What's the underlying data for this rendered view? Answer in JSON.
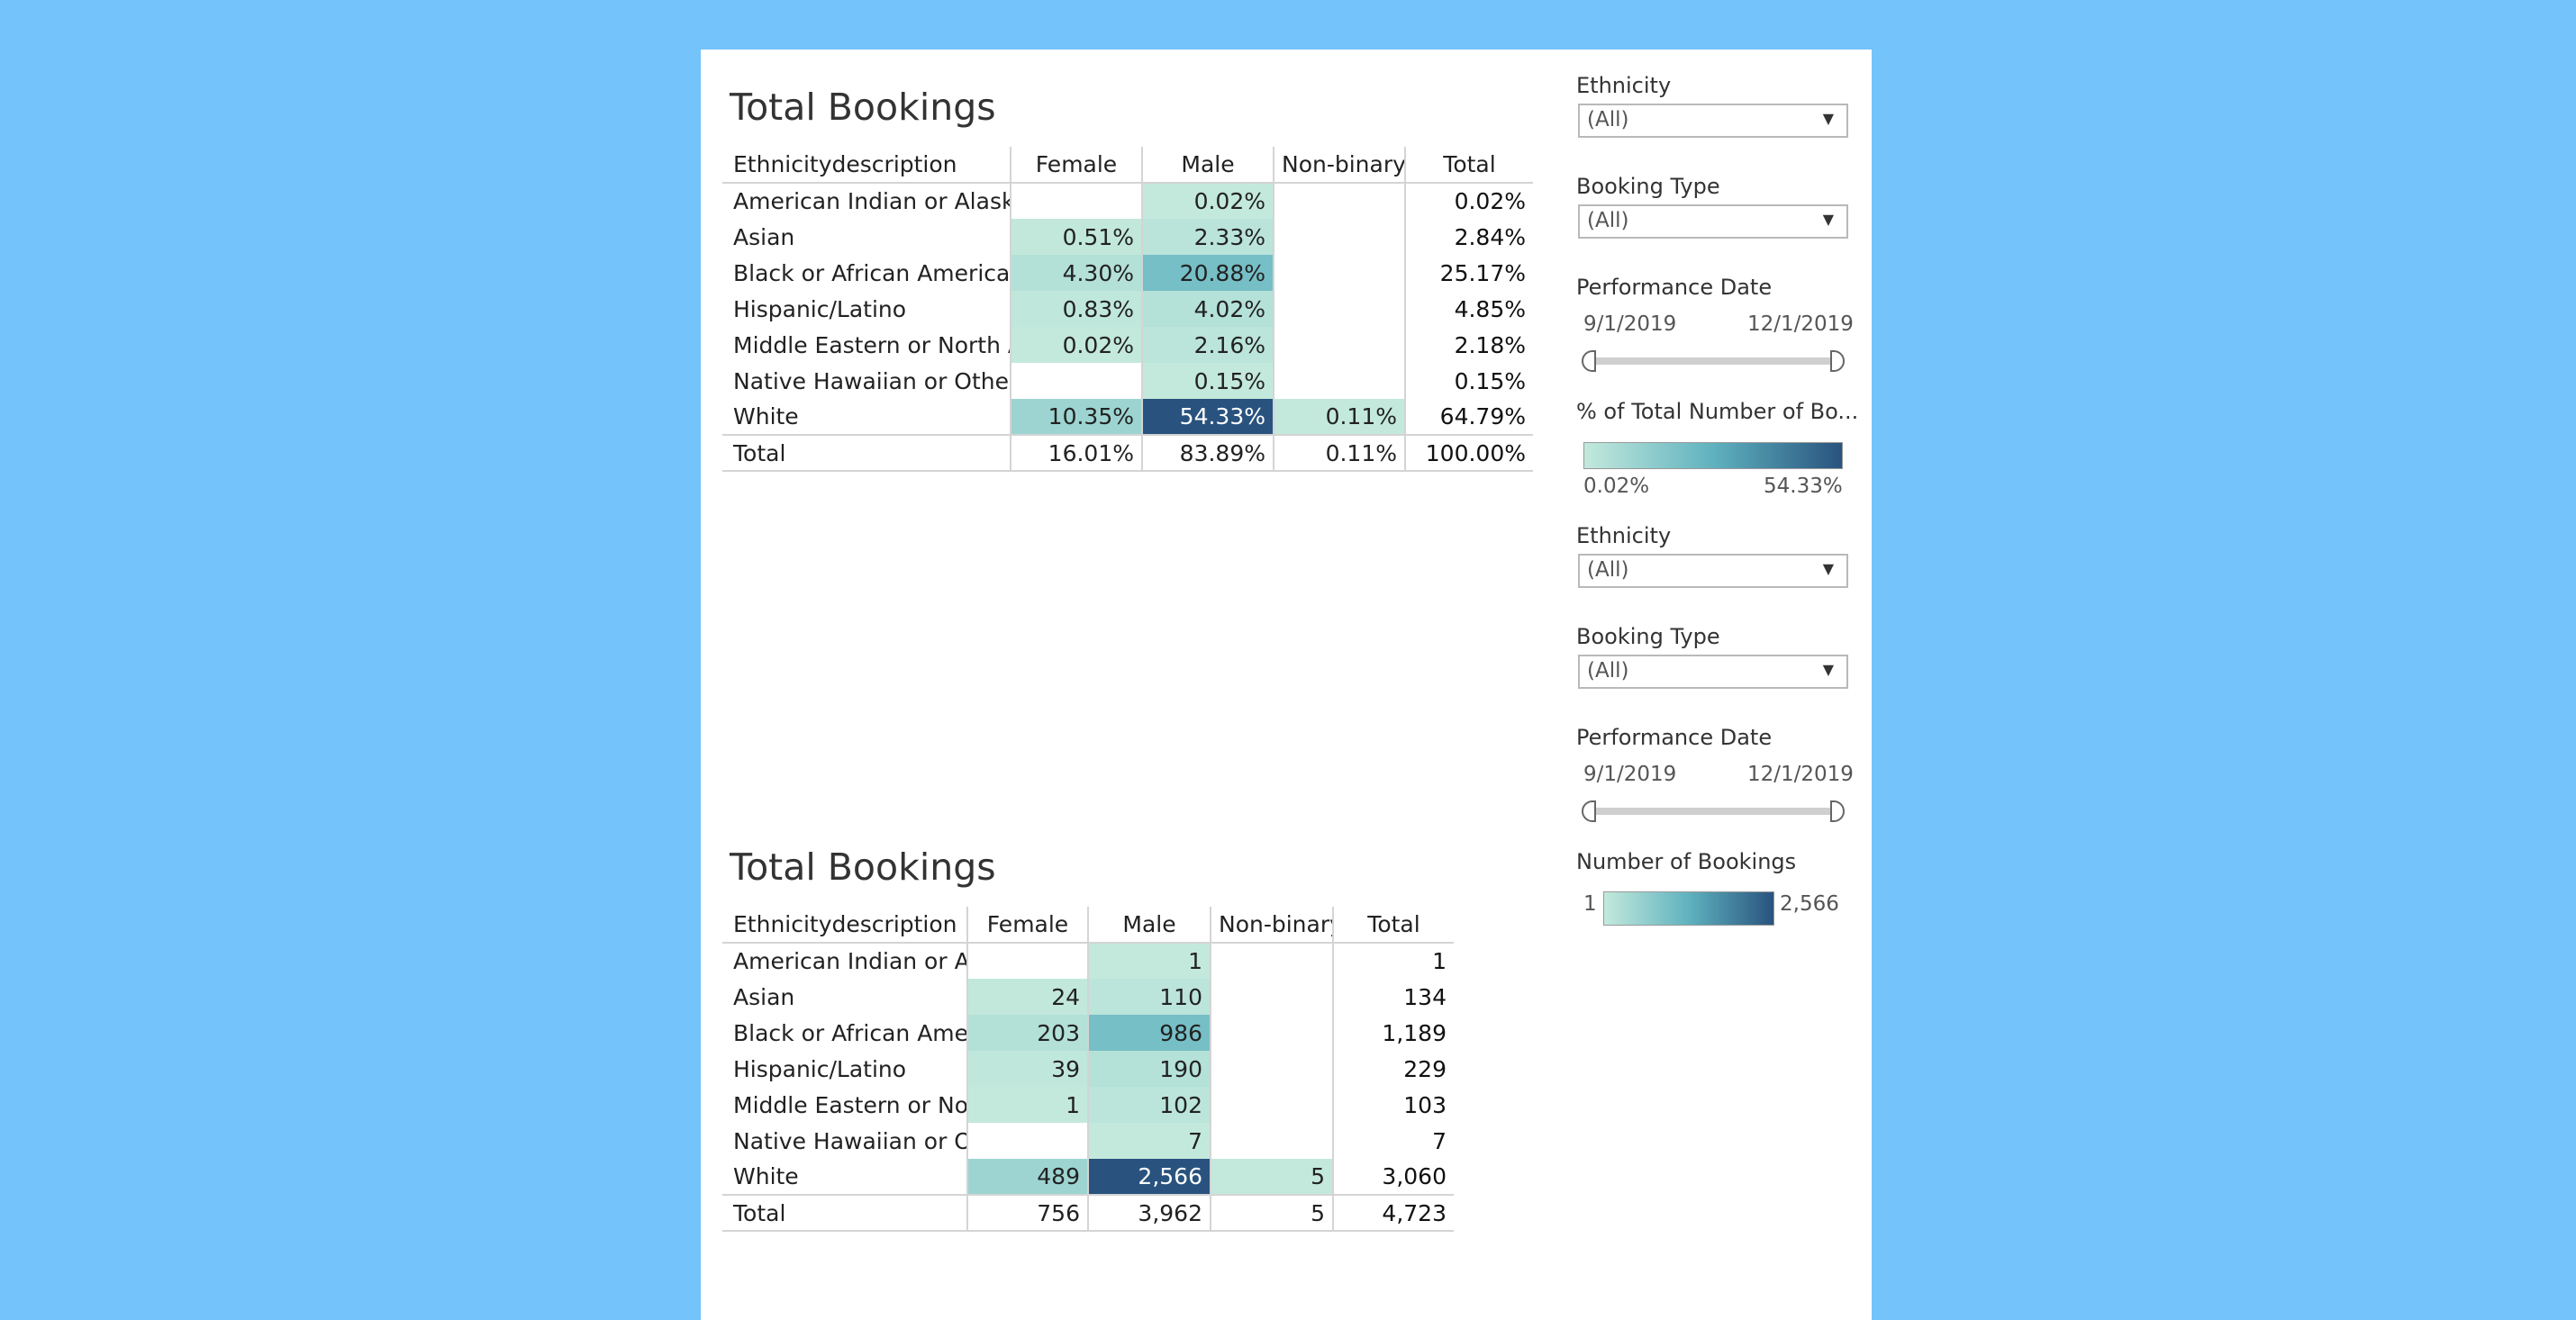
{
  "chart_data": [
    {
      "type": "table",
      "title": "Total Bookings",
      "row_header": "Ethnicitydescription",
      "columns": [
        "Female",
        "Male",
        "Non-binary",
        "Total"
      ],
      "rows": [
        {
          "label": "American Indian or Alaska..",
          "values": [
            "",
            "0.02%",
            "",
            "0.02%"
          ]
        },
        {
          "label": "Asian",
          "values": [
            "0.51%",
            "2.33%",
            "",
            "2.84%"
          ]
        },
        {
          "label": "Black or African American",
          "values": [
            "4.30%",
            "20.88%",
            "",
            "25.17%"
          ]
        },
        {
          "label": "Hispanic/Latino",
          "values": [
            "0.83%",
            "4.02%",
            "",
            "4.85%"
          ]
        },
        {
          "label": "Middle Eastern or North A..",
          "values": [
            "0.02%",
            "2.16%",
            "",
            "2.18%"
          ]
        },
        {
          "label": "Native Hawaiian or Other ..",
          "values": [
            "",
            "0.15%",
            "",
            "0.15%"
          ]
        },
        {
          "label": "White",
          "values": [
            "10.35%",
            "54.33%",
            "0.11%",
            "64.79%"
          ]
        }
      ],
      "total_row": {
        "label": "Total",
        "values": [
          "16.01%",
          "83.89%",
          "0.11%",
          "100.00%"
        ]
      },
      "cell_values": [
        [
          null,
          0.02,
          null
        ],
        [
          0.51,
          2.33,
          null
        ],
        [
          4.3,
          20.88,
          null
        ],
        [
          0.83,
          4.02,
          null
        ],
        [
          0.02,
          2.16,
          null
        ],
        [
          null,
          0.15,
          null
        ],
        [
          10.35,
          54.33,
          0.11
        ]
      ],
      "color_range": [
        0.02,
        54.33
      ]
    },
    {
      "type": "table",
      "title": "Total Bookings",
      "row_header": "Ethnicitydescription",
      "columns": [
        "Female",
        "Male",
        "Non-binary",
        "Total"
      ],
      "rows": [
        {
          "label": "American Indian or Al..",
          "values": [
            "",
            "1",
            "",
            "1"
          ]
        },
        {
          "label": "Asian",
          "values": [
            "24",
            "110",
            "",
            "134"
          ]
        },
        {
          "label": "Black or African Amer..",
          "values": [
            "203",
            "986",
            "",
            "1,189"
          ]
        },
        {
          "label": "Hispanic/Latino",
          "values": [
            "39",
            "190",
            "",
            "229"
          ]
        },
        {
          "label": "Middle Eastern or No..",
          "values": [
            "1",
            "102",
            "",
            "103"
          ]
        },
        {
          "label": "Native Hawaiian or O..",
          "values": [
            "",
            "7",
            "",
            "7"
          ]
        },
        {
          "label": "White",
          "values": [
            "489",
            "2,566",
            "5",
            "3,060"
          ]
        }
      ],
      "total_row": {
        "label": "Total",
        "values": [
          "756",
          "3,962",
          "5",
          "4,723"
        ]
      },
      "cell_values": [
        [
          null,
          1,
          null
        ],
        [
          24,
          110,
          null
        ],
        [
          203,
          986,
          null
        ],
        [
          39,
          190,
          null
        ],
        [
          1,
          102,
          null
        ],
        [
          null,
          7,
          null
        ],
        [
          489,
          2566,
          5
        ]
      ],
      "color_range": [
        1,
        2566
      ]
    }
  ],
  "colors": {
    "background": "#74c3fb",
    "scale_low": "#c3e9dc",
    "scale_mid": "#5fb2bf",
    "scale_high": "#29537e"
  },
  "filters_top": {
    "ethnicity_label": "Ethnicity",
    "ethnicity_value": "(All)",
    "booking_type_label": "Booking Type",
    "booking_type_value": "(All)",
    "perf_date_label": "Performance Date",
    "date_start": "9/1/2019",
    "date_end": "12/1/2019",
    "legend_title": "% of Total Number of Bo...",
    "legend_min": "0.02%",
    "legend_max": "54.33%"
  },
  "filters_bottom": {
    "ethnicity_label": "Ethnicity",
    "ethnicity_value": "(All)",
    "booking_type_label": "Booking Type",
    "booking_type_value": "(All)",
    "perf_date_label": "Performance Date",
    "date_start": "9/1/2019",
    "date_end": "12/1/2019",
    "legend_title": "Number of Bookings",
    "legend_min": "1",
    "legend_max": "2,566"
  }
}
